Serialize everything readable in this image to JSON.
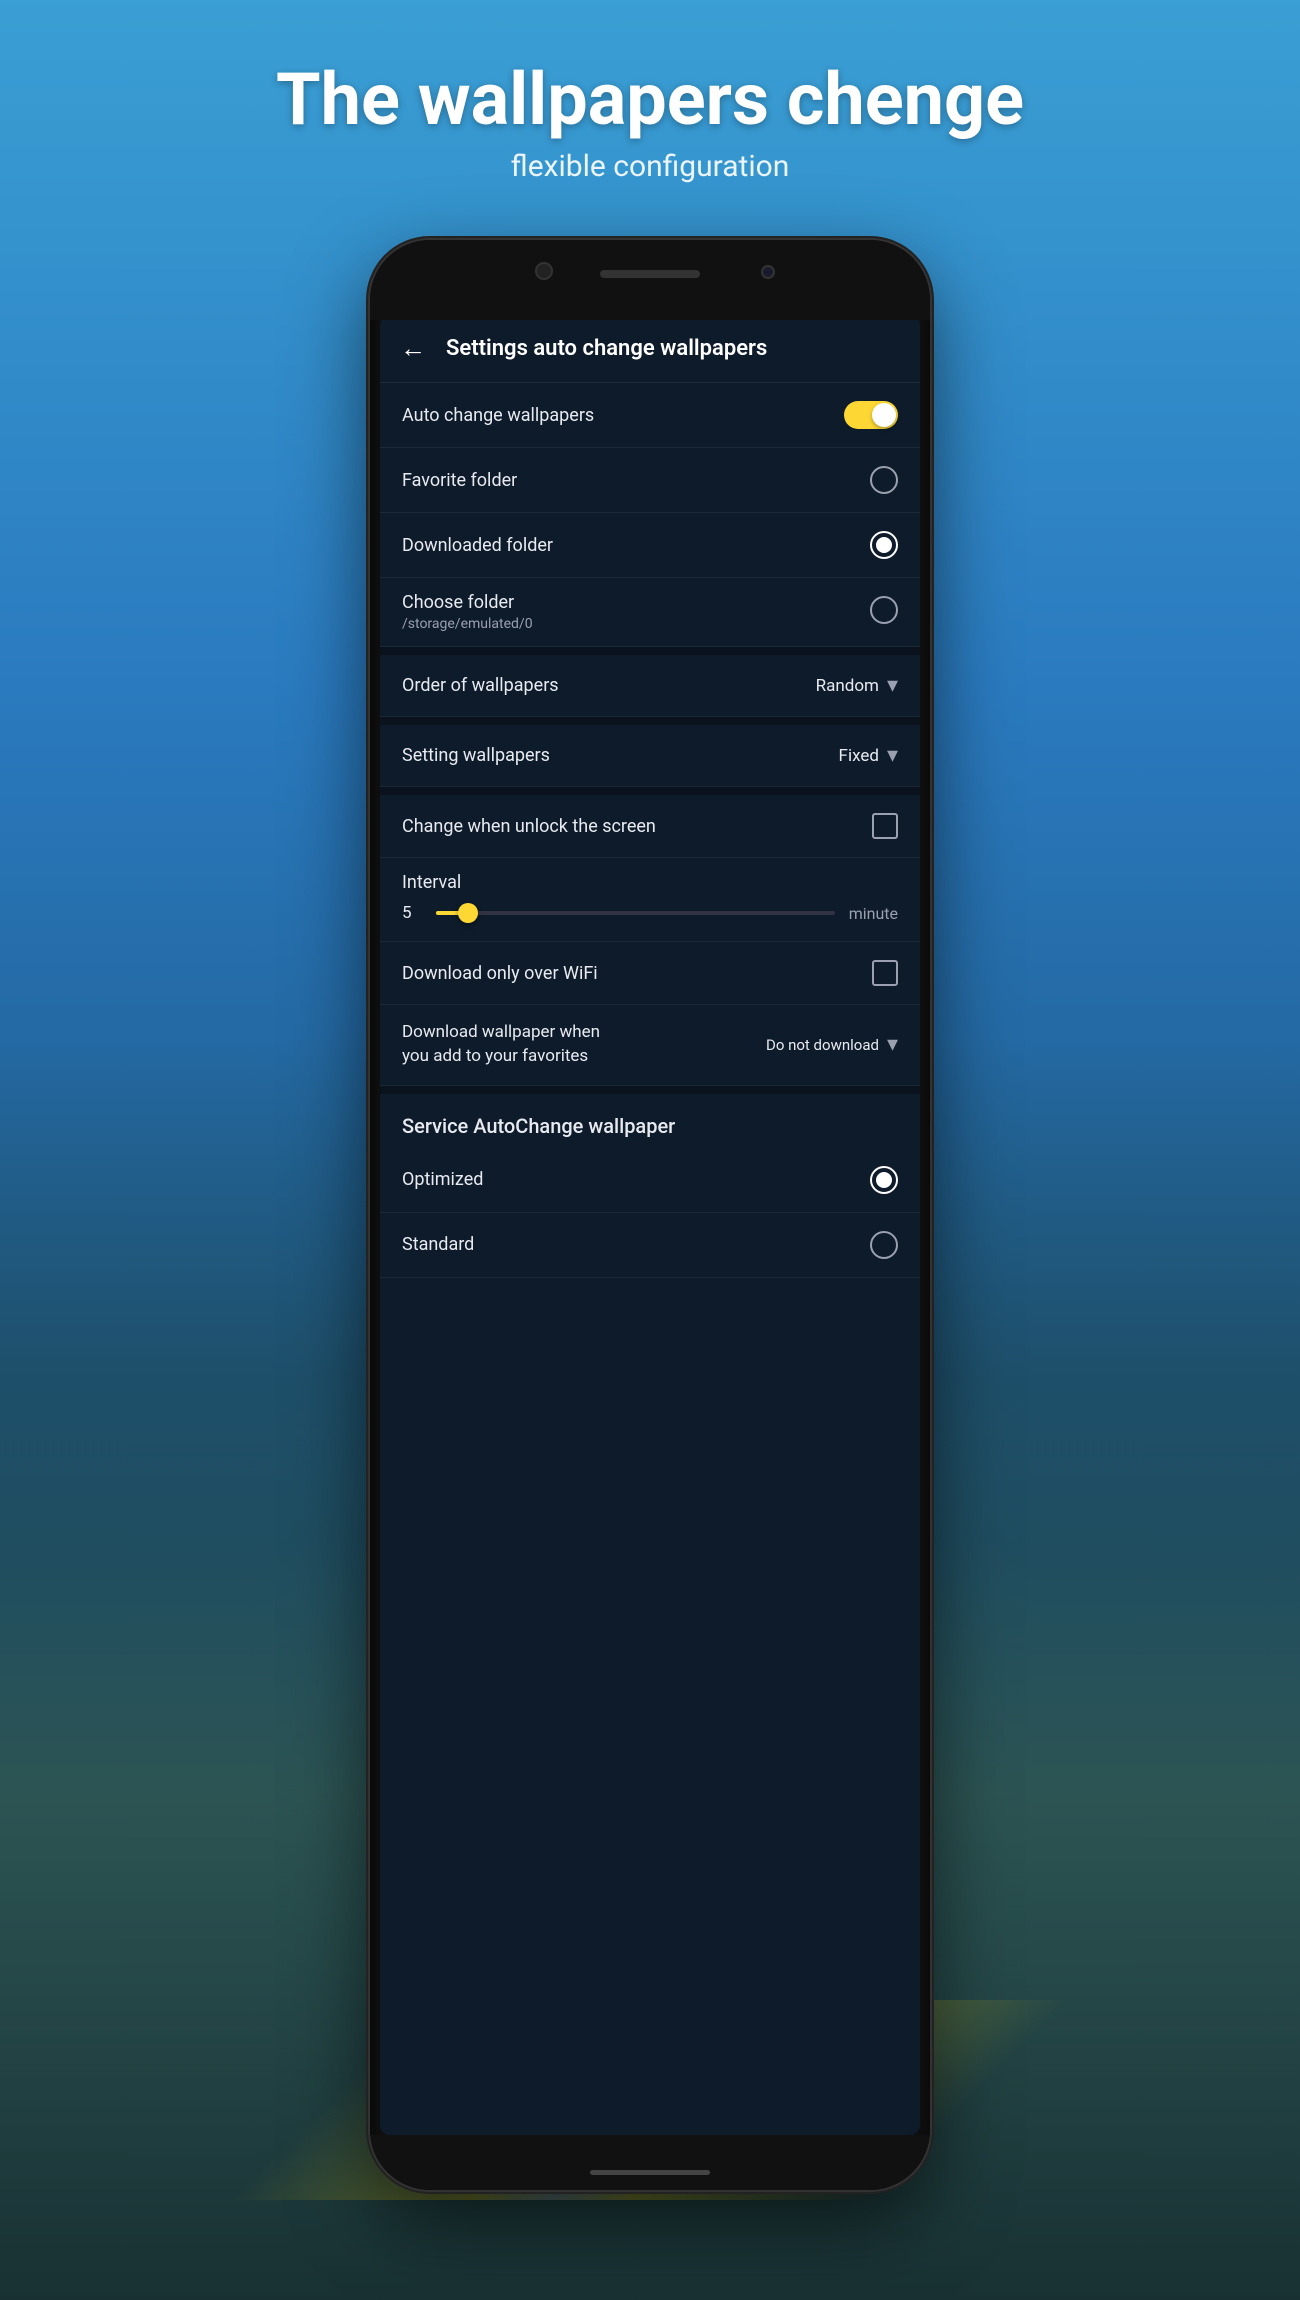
{
  "page": {
    "main_title": "The wallpapers chenge",
    "sub_title": "flexible configuration"
  },
  "header": {
    "back_label": "←",
    "title": "Settings auto change wallpapers"
  },
  "settings": {
    "auto_change": {
      "label": "Auto change wallpapers",
      "toggle_state": "on"
    },
    "favorite_folder": {
      "label": "Favorite folder",
      "selected": false
    },
    "downloaded_folder": {
      "label": "Downloaded folder",
      "selected": true
    },
    "choose_folder": {
      "label": "Choose folder",
      "sublabel": "/storage/emulated/0",
      "selected": false
    },
    "order_wallpapers": {
      "label": "Order of wallpapers",
      "value": "Random"
    },
    "setting_wallpapers": {
      "label": "Setting wallpapers",
      "value": "Fixed"
    },
    "change_unlock": {
      "label": "Change when unlock the screen",
      "checked": false
    },
    "interval": {
      "label": "Interval",
      "value": "5",
      "unit": "minute",
      "min": 1,
      "max": 60,
      "fill_percent": 8
    },
    "download_wifi": {
      "label": "Download only over WiFi",
      "checked": false
    },
    "download_favorites": {
      "label": "Download wallpaper when you add to your favorites",
      "value": "Do not download"
    },
    "service_section": {
      "label": "Service AutoChange wallpaper"
    },
    "optimized": {
      "label": "Optimized",
      "selected": true
    },
    "standard": {
      "label": "Standard",
      "selected": false
    }
  },
  "icons": {
    "back": "←",
    "dropdown_arrow": "▾",
    "radio_empty": "○",
    "radio_filled": "◉",
    "checkbox_empty": "☐",
    "checkbox_checked": "☑"
  }
}
